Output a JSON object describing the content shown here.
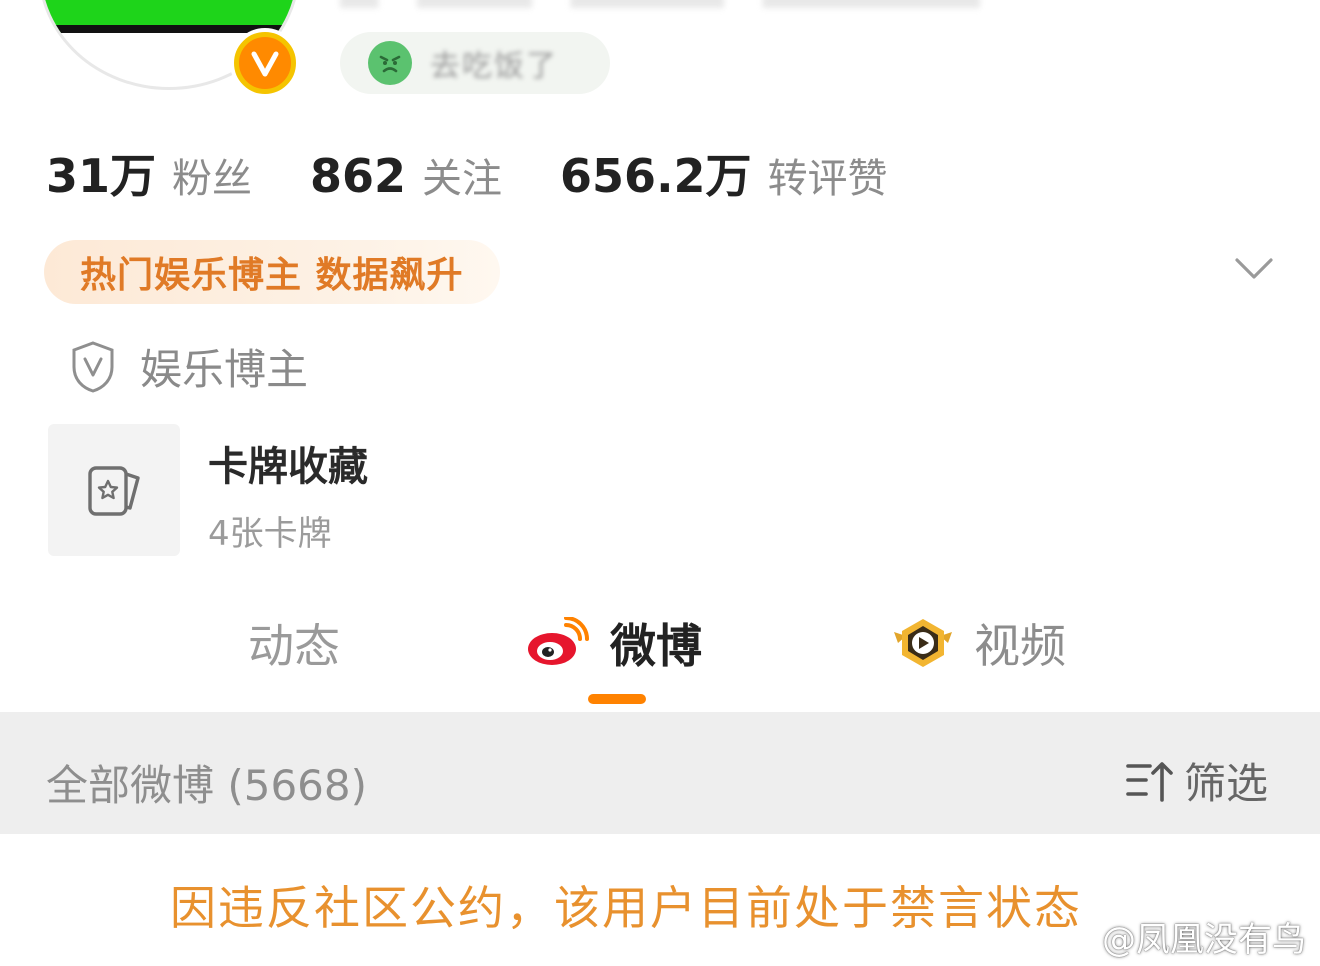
{
  "profile": {
    "mood_status": "去吃饭了",
    "verified": true
  },
  "stats": [
    {
      "value": "31万",
      "label": "粉丝"
    },
    {
      "value": "862",
      "label": "关注"
    },
    {
      "value": "656.2万",
      "label": "转评赞"
    }
  ],
  "hot_tag": "热门娱乐博主 数据飙升",
  "verification": {
    "text": "娱乐博主",
    "icon": "shield-v-icon"
  },
  "card_collection": {
    "title": "卡牌收藏",
    "subtitle": "4张卡牌",
    "icon": "card-star-icon"
  },
  "tabs": [
    {
      "label": "动态",
      "active": false
    },
    {
      "label": "微博",
      "active": true,
      "icon": "weibo-logo-icon"
    },
    {
      "label": "视频",
      "active": false,
      "icon": "video-play-icon"
    }
  ],
  "feed_bar": {
    "all_label": "全部微博 (5668)",
    "filter_label": "筛选"
  },
  "notice": "因违反社区公约，该用户目前处于禁言状态",
  "watermark": "@凤凰没有鸟",
  "colors": {
    "accent": "#ff8200",
    "notice": "#e8912e",
    "avatar_green": "#1ed41a",
    "mood_green": "#5bc26f"
  }
}
